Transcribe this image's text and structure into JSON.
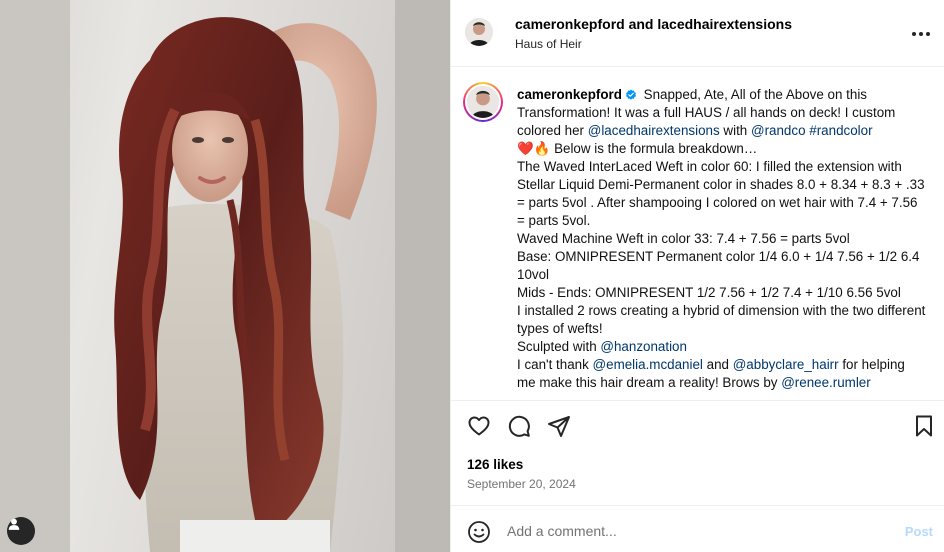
{
  "post": {
    "header": {
      "author_1": "cameronkepford",
      "joiner": " and ",
      "author_2": "lacedhairextensions",
      "location": "Haus of Heir",
      "more_icon": "more-horizontal-icon"
    },
    "caption": {
      "username": "cameronkepford",
      "verified_icon": "verified-badge-icon",
      "lines": {
        "intro": "Snapped, Ate, All of the Above on this Transformation! It was a full HAUS / all hands on deck! I custom colored her",
        "mention_laced": "@lacedhairextensions",
        "with": "with",
        "mention_randco": "@randco",
        "hashtag_randcolor": "#randcolor",
        "emoji_line": "❤️🔥 Below is the formula breakdown…",
        "weft60": "The Waved InterLaced Weft in color 60: I filled the extension with Stellar Liquid Demi-Permanent color in shades 8.0 + 8.34 + 8.3 + .33 = parts 5vol . After shampooing I colored on wet hair with 7.4 + 7.56 = parts 5vol.",
        "weft33": "Waved Machine Weft in color 33: 7.4 + 7.56 = parts 5vol",
        "base": "Base: OMNIPRESENT Permanent color 1/4 6.0 + 1/4 7.56 + 1/2 6.4 10vol",
        "mids": "Mids - Ends: OMNIPRESENT 1/2 7.56 + 1/2 7.4 + 1/10 6.56 5vol",
        "rows": "I installed 2 rows creating a hybrid of dimension with the two different types of wefts!",
        "sculpted": "Sculpted with",
        "mention_hanzo": "@hanzonation",
        "thanks_a": "I can't thank",
        "mention_emelia": "@emelia.mcdaniel",
        "and": "and",
        "mention_abby": "@abbyclare_hairr",
        "thanks_b": "for helping me make this hair dream a reality! Brows by",
        "mention_renee": "@renee.rumler"
      }
    },
    "actions": {
      "like_icon": "heart-icon",
      "comment_icon": "comment-icon",
      "share_icon": "share-icon",
      "save_icon": "bookmark-icon"
    },
    "likes": "126 likes",
    "date": "September 20, 2024",
    "comment": {
      "emoji_icon": "emoji-icon",
      "placeholder": "Add a comment...",
      "post_label": "Post"
    },
    "media": {
      "user_tag_icon": "user-tag-icon"
    },
    "colors": {
      "link": "#00376b",
      "post_disabled": "#b6d9fb",
      "verified": "#0095f6",
      "muted": "#737373"
    }
  }
}
